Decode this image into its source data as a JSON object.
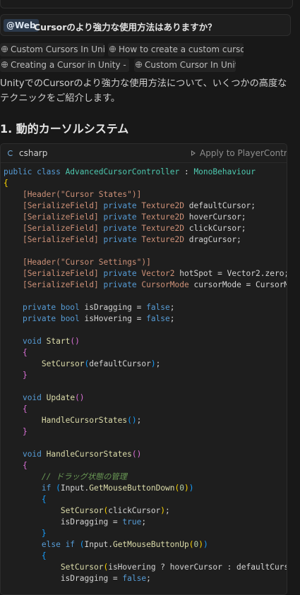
{
  "query": {
    "tag": "@Web",
    "text": "Cursorのより強力な使用方法はありますか？"
  },
  "links": [
    "Custom Cursors In Unity",
    "How to create a custom cursor ...",
    "Creating a Cursor in Unity - D...",
    "Custom Cursor In Unity"
  ],
  "intro": "UnityでのCursorのより強力な使用方法について、いくつかの高度なテクニックをご紹介します。",
  "section_heading": "1. 動的カーソルシステム",
  "code_block": {
    "language": "csharp",
    "apply_label": "Apply to PlayerContro..."
  },
  "code_lines": [
    [
      [
        "kw",
        "public class "
      ],
      [
        "ty",
        "AdvancedCursorController"
      ],
      [
        "vr",
        " : "
      ],
      [
        "ty",
        "MonoBehaviour"
      ]
    ],
    [
      [
        "br1",
        "{"
      ]
    ],
    [
      [
        "vr",
        "    "
      ],
      [
        "cn",
        "[Header("
      ],
      [
        "st",
        "\"Cursor States\""
      ],
      [
        "cn",
        ")]"
      ]
    ],
    [
      [
        "vr",
        "    "
      ],
      [
        "cn",
        "[SerializeField]"
      ],
      [
        "kw",
        " private "
      ],
      [
        "cn",
        "Texture2D"
      ],
      [
        "vr",
        " defaultCursor;"
      ]
    ],
    [
      [
        "vr",
        "    "
      ],
      [
        "cn",
        "[SerializeField]"
      ],
      [
        "kw",
        " private "
      ],
      [
        "cn",
        "Texture2D"
      ],
      [
        "vr",
        " hoverCursor;"
      ]
    ],
    [
      [
        "vr",
        "    "
      ],
      [
        "cn",
        "[SerializeField]"
      ],
      [
        "kw",
        " private "
      ],
      [
        "cn",
        "Texture2D"
      ],
      [
        "vr",
        " clickCursor;"
      ]
    ],
    [
      [
        "vr",
        "    "
      ],
      [
        "cn",
        "[SerializeField]"
      ],
      [
        "kw",
        " private "
      ],
      [
        "cn",
        "Texture2D"
      ],
      [
        "vr",
        " dragCursor;"
      ]
    ],
    [],
    [
      [
        "vr",
        "    "
      ],
      [
        "cn",
        "[Header("
      ],
      [
        "st",
        "\"Cursor Settings\""
      ],
      [
        "cn",
        ")]"
      ]
    ],
    [
      [
        "vr",
        "    "
      ],
      [
        "cn",
        "[SerializeField]"
      ],
      [
        "kw",
        " private "
      ],
      [
        "cn",
        "Vector2"
      ],
      [
        "vr",
        " hotSpot = Vector2.zero;"
      ]
    ],
    [
      [
        "vr",
        "    "
      ],
      [
        "cn",
        "[SerializeField]"
      ],
      [
        "kw",
        " private "
      ],
      [
        "cn",
        "CursorMode"
      ],
      [
        "vr",
        " cursorMode = CursorM"
      ]
    ],
    [],
    [
      [
        "vr",
        "    "
      ],
      [
        "kw",
        "private bool"
      ],
      [
        "vr",
        " isDragging = "
      ],
      [
        "kw",
        "false"
      ],
      [
        "vr",
        ";"
      ]
    ],
    [
      [
        "vr",
        "    "
      ],
      [
        "kw",
        "private bool"
      ],
      [
        "vr",
        " isHovering = "
      ],
      [
        "kw",
        "false"
      ],
      [
        "vr",
        ";"
      ]
    ],
    [],
    [
      [
        "vr",
        "    "
      ],
      [
        "kw",
        "void "
      ],
      [
        "fn",
        "Start"
      ],
      [
        "br2",
        "()"
      ]
    ],
    [
      [
        "vr",
        "    "
      ],
      [
        "br2",
        "{"
      ]
    ],
    [
      [
        "vr",
        "        "
      ],
      [
        "fn",
        "SetCursor"
      ],
      [
        "br3",
        "("
      ],
      [
        "vr",
        "defaultCursor"
      ],
      [
        "br3",
        ")"
      ],
      [
        "vr",
        ";"
      ]
    ],
    [
      [
        "vr",
        "    "
      ],
      [
        "br2",
        "}"
      ]
    ],
    [],
    [
      [
        "vr",
        "    "
      ],
      [
        "kw",
        "void "
      ],
      [
        "fn",
        "Update"
      ],
      [
        "br2",
        "()"
      ]
    ],
    [
      [
        "vr",
        "    "
      ],
      [
        "br2",
        "{"
      ]
    ],
    [
      [
        "vr",
        "        "
      ],
      [
        "fn",
        "HandleCursorStates"
      ],
      [
        "br3",
        "()"
      ],
      [
        "vr",
        ";"
      ]
    ],
    [
      [
        "vr",
        "    "
      ],
      [
        "br2",
        "}"
      ]
    ],
    [],
    [
      [
        "vr",
        "    "
      ],
      [
        "kw",
        "void "
      ],
      [
        "fn",
        "HandleCursorStates"
      ],
      [
        "br2",
        "()"
      ]
    ],
    [
      [
        "vr",
        "    "
      ],
      [
        "br2",
        "{"
      ]
    ],
    [
      [
        "vr",
        "        "
      ],
      [
        "cm",
        "// ドラッグ状態の管理"
      ]
    ],
    [
      [
        "vr",
        "        "
      ],
      [
        "kw",
        "if "
      ],
      [
        "br3",
        "("
      ],
      [
        "vr",
        "Input."
      ],
      [
        "fn",
        "GetMouseButtonDown"
      ],
      [
        "br1",
        "("
      ],
      [
        "nm",
        "0"
      ],
      [
        "br1",
        ")"
      ],
      [
        "br3",
        ")"
      ]
    ],
    [
      [
        "vr",
        "        "
      ],
      [
        "br3",
        "{"
      ]
    ],
    [
      [
        "vr",
        "            "
      ],
      [
        "fn",
        "SetCursor"
      ],
      [
        "br1",
        "("
      ],
      [
        "vr",
        "clickCursor"
      ],
      [
        "br1",
        ")"
      ],
      [
        "vr",
        ";"
      ]
    ],
    [
      [
        "vr",
        "            isDragging = "
      ],
      [
        "kw",
        "true"
      ],
      [
        "vr",
        ";"
      ]
    ],
    [
      [
        "vr",
        "        "
      ],
      [
        "br3",
        "}"
      ]
    ],
    [
      [
        "vr",
        "        "
      ],
      [
        "kw",
        "else if "
      ],
      [
        "br3",
        "("
      ],
      [
        "vr",
        "Input."
      ],
      [
        "fn",
        "GetMouseButtonUp"
      ],
      [
        "br1",
        "("
      ],
      [
        "nm",
        "0"
      ],
      [
        "br1",
        ")"
      ],
      [
        "br3",
        ")"
      ]
    ],
    [
      [
        "vr",
        "        "
      ],
      [
        "br3",
        "{"
      ]
    ],
    [
      [
        "vr",
        "            "
      ],
      [
        "fn",
        "SetCursor"
      ],
      [
        "br1",
        "("
      ],
      [
        "vr",
        "isHovering ? hoverCursor : defaultCurs"
      ]
    ],
    [
      [
        "vr",
        "            isDragging = "
      ],
      [
        "kw",
        "false"
      ],
      [
        "vr",
        ";"
      ]
    ]
  ]
}
